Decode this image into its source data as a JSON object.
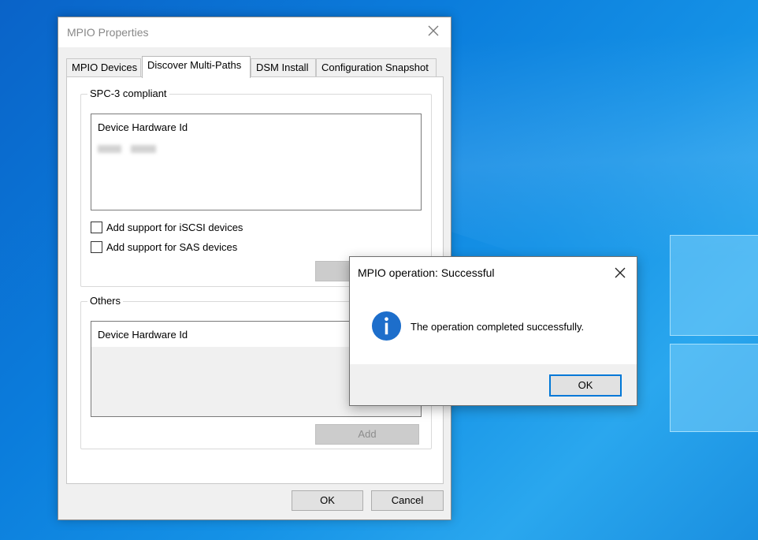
{
  "colors": {
    "accent": "#0078d7",
    "info_icon": "#1d6ecb",
    "desktop": "#0b7ddc"
  },
  "main_window": {
    "title": "MPIO Properties",
    "tabs": [
      {
        "label": "MPIO Devices"
      },
      {
        "label": "Discover Multi-Paths",
        "active": true
      },
      {
        "label": "DSM Install"
      },
      {
        "label": "Configuration Snapshot"
      }
    ],
    "spc3": {
      "group_label": "SPC-3 compliant",
      "list_header": "Device Hardware Id",
      "checkbox_iscsi": "Add support for iSCSI devices",
      "checkbox_sas": "Add support for SAS devices"
    },
    "others": {
      "group_label": "Others",
      "list_header": "Device Hardware Id",
      "add_button": "Add"
    },
    "ok_button": "OK",
    "cancel_button": "Cancel"
  },
  "message_box": {
    "title": "MPIO operation: Successful",
    "icon": "info-icon",
    "message": "The operation completed successfully.",
    "ok_button": "OK"
  }
}
